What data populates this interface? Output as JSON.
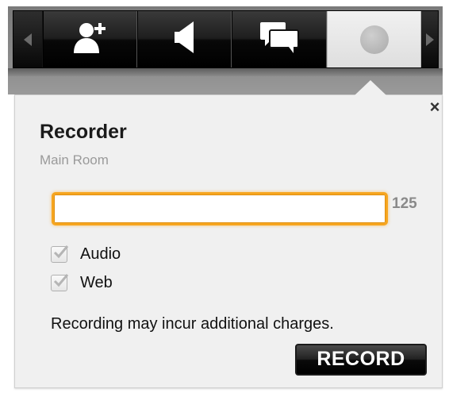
{
  "toolbar": {
    "buttons": [
      {
        "icon": "add-user-icon",
        "active": false
      },
      {
        "icon": "speaker-icon",
        "active": false
      },
      {
        "icon": "chat-icon",
        "active": false
      },
      {
        "icon": "record-dot-icon",
        "active": true
      }
    ],
    "left_arrow_icon": "chevron-left-icon",
    "right_arrow_icon": "chevron-right-icon"
  },
  "panel": {
    "close_label": "×",
    "title": "Recorder",
    "subtitle": "Main Room",
    "name_input": {
      "value": "",
      "placeholder": ""
    },
    "char_count": "125",
    "checkboxes": [
      {
        "label": "Audio",
        "checked": true
      },
      {
        "label": "Web",
        "checked": true
      }
    ],
    "notice": "Recording may incur additional charges.",
    "record_label": "RECORD"
  },
  "colors": {
    "accent_orange": "#f6a51f",
    "toolbar_dark": "#141414",
    "panel_bg": "#f0f0f0"
  }
}
